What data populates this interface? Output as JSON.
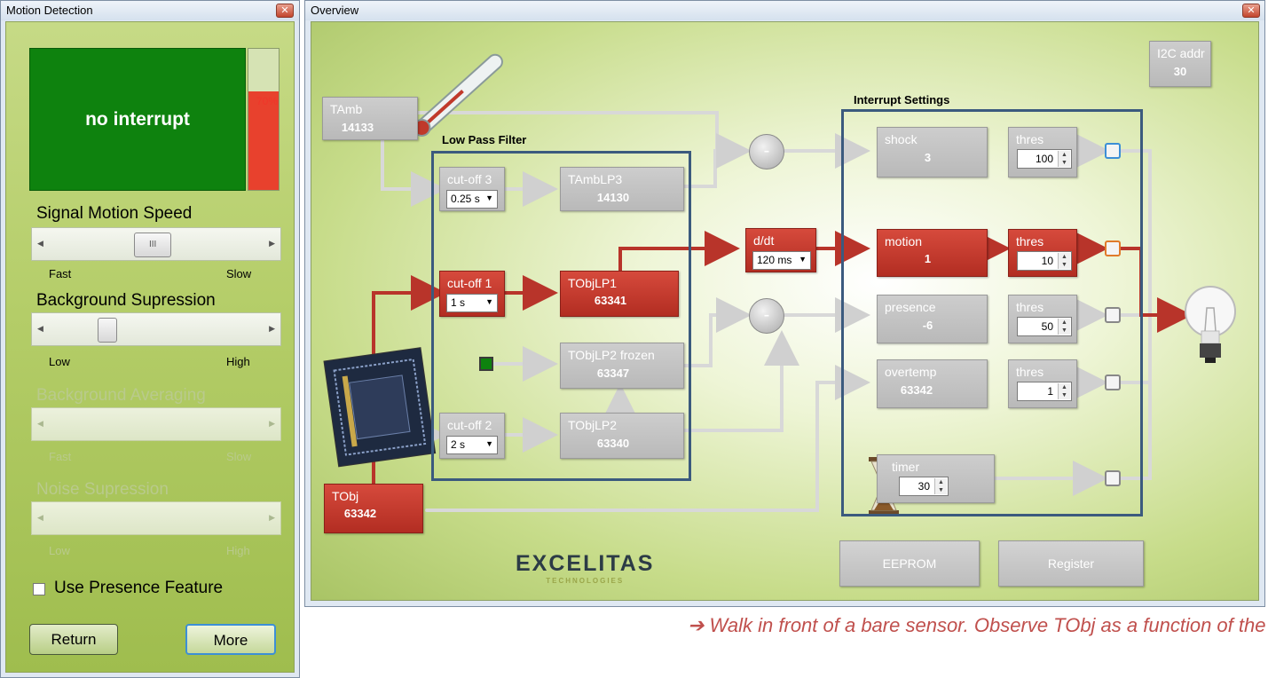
{
  "motion_window": {
    "title": "Motion Detection",
    "status_text": "no interrupt",
    "level_percent": 70,
    "level_text": "70%",
    "sliders": [
      {
        "label": "Signal Motion Speed",
        "min_label": "Fast",
        "max_label": "Slow",
        "thumb_glyph": "III",
        "value_fraction": 0.48,
        "enabled": true
      },
      {
        "label": "Background Supression",
        "min_label": "Low",
        "max_label": "High",
        "thumb_glyph": "",
        "value_fraction": 0.27,
        "enabled": true
      },
      {
        "label": "Background Averaging",
        "min_label": "Fast",
        "max_label": "Slow",
        "enabled": false
      },
      {
        "label": "Noise Supression",
        "min_label": "Low",
        "max_label": "High",
        "enabled": false
      }
    ],
    "presence_label": "Use Presence Feature",
    "presence_checked": false,
    "return_label": "Return",
    "more_label": "More"
  },
  "overview_window": {
    "title": "Overview",
    "i2c": {
      "label": "I2C addr",
      "value": "30"
    },
    "lpf_title": "Low Pass Filter",
    "interrupt_title": "Interrupt Settings",
    "tamb": {
      "label": "TAmb",
      "value": "14133"
    },
    "tobj": {
      "label": "TObj",
      "value": "63342"
    },
    "cutoff3": {
      "label": "cut-off 3",
      "value": "0.25 s"
    },
    "cutoff1": {
      "label": "cut-off 1",
      "value": "1 s"
    },
    "cutoff2": {
      "label": "cut-off 2",
      "value": "2 s"
    },
    "tamblp3": {
      "label": "TAmbLP3",
      "value": "14130"
    },
    "tobjlp1": {
      "label": "TObjLP1",
      "value": "63341"
    },
    "tobjlp2frozen": {
      "label": "TObjLP2 frozen",
      "value": "63347"
    },
    "tobjlp2": {
      "label": "TObjLP2",
      "value": "63340"
    },
    "ddt": {
      "label": "d/dt",
      "value": "120 ms"
    },
    "minus_glyph": "-",
    "shock": {
      "label": "shock",
      "value": "3",
      "thres_label": "thres",
      "thres": "100"
    },
    "motion": {
      "label": "motion",
      "value": "1",
      "thres_label": "thres",
      "thres": "10"
    },
    "presence": {
      "label": "presence",
      "value": "-6",
      "thres_label": "thres",
      "thres": "50"
    },
    "overtemp": {
      "label": "overtemp",
      "value": "63342",
      "thres_label": "thres",
      "thres": "1"
    },
    "timer": {
      "label": "timer",
      "value": "30"
    },
    "eeprom_label": "EEPROM",
    "register_label": "Register",
    "logo_main": "EXCELITAS",
    "logo_sub": "TECHNOLOGIES"
  },
  "note_text": "➔  Walk in front of a bare sensor. Observe TObj as a function of the time for varying",
  "colors": {
    "active_red": "#c0392b",
    "interrupt_green": "#0e820e",
    "frame_blue": "#3b5a7e",
    "note_red": "#c0504d"
  }
}
